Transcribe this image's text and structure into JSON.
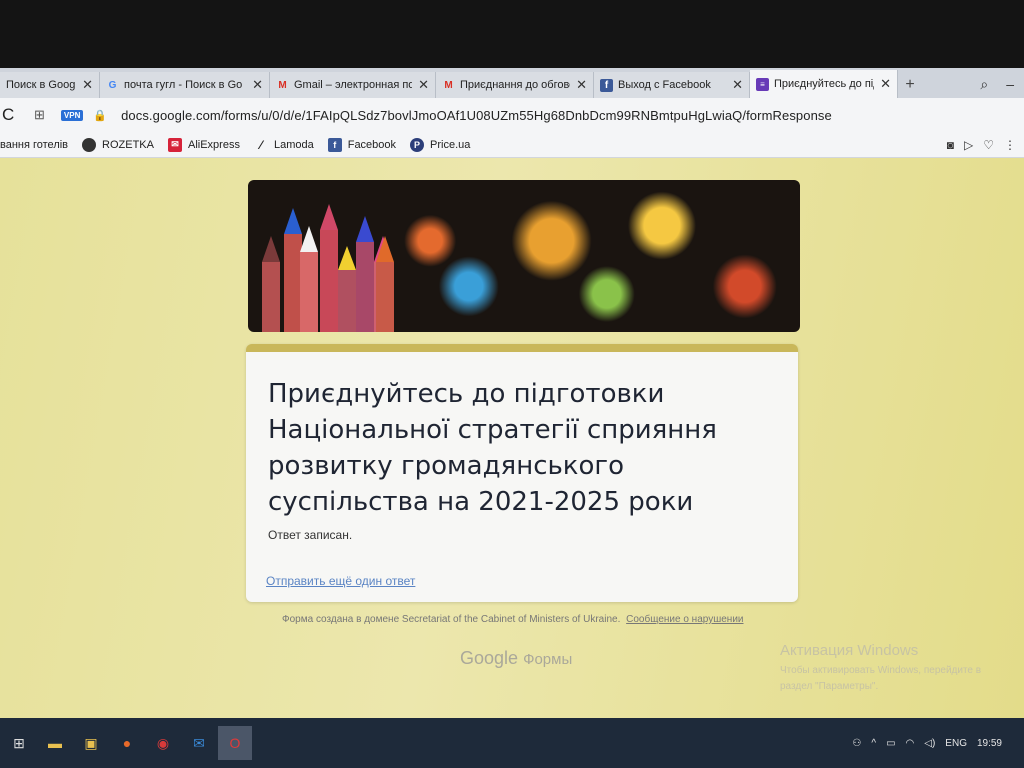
{
  "tabs": [
    {
      "title": "Поиск в Google",
      "icon": "google-icon",
      "active": false
    },
    {
      "title": "почта гугл - Поиск в Go",
      "icon": "google-g-icon",
      "active": false
    },
    {
      "title": "Gmail – электронная по",
      "icon": "gmail-icon",
      "active": false
    },
    {
      "title": "Приєднання до обговор",
      "icon": "gmail-icon",
      "active": false
    },
    {
      "title": "Выход с Facebook",
      "icon": "facebook-icon",
      "active": false
    },
    {
      "title": "Приєднуйтесь до підгот",
      "icon": "forms-icon",
      "active": true
    }
  ],
  "address": {
    "vpn": "VPN",
    "url": "docs.google.com/forms/u/0/d/e/1FAIpQLSdz7bovlJmoOAf1U08UZm55Hg68DnbDcm99RNBmtpuHgLwiaQ/formResponse"
  },
  "bookmarks": [
    {
      "label": "вання готелів",
      "icon": ""
    },
    {
      "label": "ROZETKA",
      "icon": "rozetka-icon"
    },
    {
      "label": "AliExpress",
      "icon": "aliexpress-icon"
    },
    {
      "label": "Lamoda",
      "icon": "lamoda-icon"
    },
    {
      "label": "Facebook",
      "icon": "facebook-icon"
    },
    {
      "label": "Price.ua",
      "icon": "price-icon"
    }
  ],
  "form": {
    "title": "Приєднуйтесь до підготовки Національної стратегії сприяння розвитку громадянського суспільства на 2021-2025 роки",
    "confirmation": "Ответ записан.",
    "submit_another": "Отправить ещё один ответ"
  },
  "footer": {
    "created_in": "Форма создана в домене Secretariat of the Cabinet of Ministers of Ukraine.",
    "report": "Сообщение о нарушении",
    "brand_google": "Google",
    "brand_forms": "Формы"
  },
  "activation": {
    "title": "Активация Windows",
    "line1": "Чтобы активировать Windows, перейдите в",
    "line2": "раздел \"Параметры\"."
  },
  "taskbar": {
    "lang": "ENG",
    "time": "19:59"
  },
  "colors": {
    "page_bg": "#e8e3a2",
    "card_accent": "#c9b75a",
    "link": "#5a84c4"
  }
}
